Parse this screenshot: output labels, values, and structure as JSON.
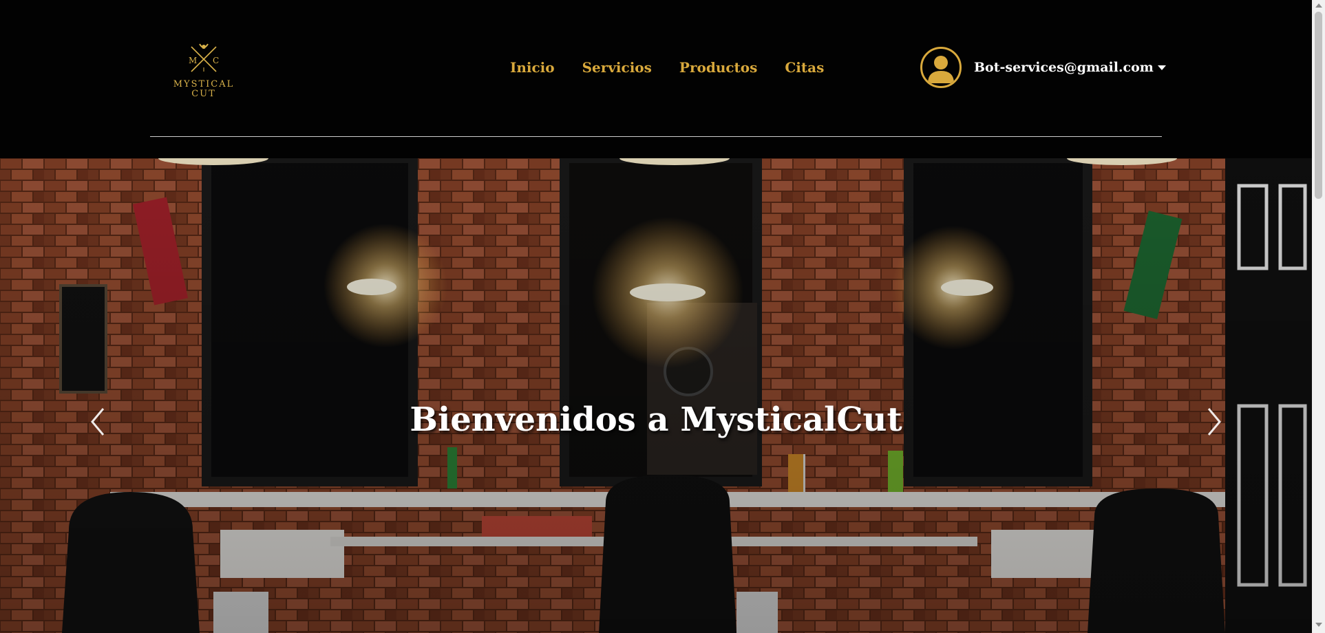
{
  "header": {
    "logo": {
      "initials_left": "M",
      "initials_right": "C",
      "line1": "MYSTICAL",
      "line2": "CUT"
    },
    "nav": [
      {
        "label": "Inicio"
      },
      {
        "label": "Servicios"
      },
      {
        "label": "Productos"
      },
      {
        "label": "Citas"
      }
    ],
    "user": {
      "email": "Bot-services@gmail.com",
      "avatar_icon": "user-circle-icon",
      "dropdown_icon": "caret-down-icon"
    }
  },
  "hero": {
    "title": "Bienvenidos a MysticalCut",
    "prev_icon": "chevron-left-icon",
    "next_icon": "chevron-right-icon"
  },
  "colors": {
    "header_bg": "#020202",
    "accent_gold": "#d9a93c",
    "text_white": "#ffffff"
  }
}
